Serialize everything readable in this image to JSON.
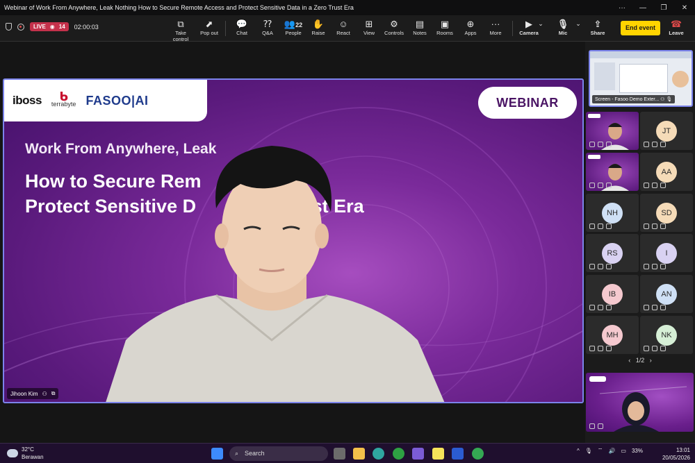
{
  "window": {
    "title": "Webinar of Work From Anywhere, Leak Nothing How to Secure Remote Access and Protect Sensitive Data in a Zero Trust Era",
    "controls": [
      "···",
      "—",
      "❐",
      "✕"
    ]
  },
  "toolbar": {
    "live_label": "LIVE",
    "viewer_count": "14",
    "timer": "02:00:03",
    "tools": [
      {
        "label": "Take control",
        "icon": "take-control-icon"
      },
      {
        "label": "Pop out",
        "icon": "pop-out-icon"
      },
      {
        "label": "Chat",
        "icon": "chat-icon"
      },
      {
        "label": "Q&A",
        "icon": "qa-icon"
      },
      {
        "label": "People",
        "icon": "people-icon",
        "count": "22"
      },
      {
        "label": "Raise",
        "icon": "raise-hand-icon"
      },
      {
        "label": "React",
        "icon": "react-icon"
      },
      {
        "label": "View",
        "icon": "view-icon"
      },
      {
        "label": "Controls",
        "icon": "controls-icon"
      },
      {
        "label": "Notes",
        "icon": "notes-icon"
      },
      {
        "label": "Rooms",
        "icon": "rooms-icon"
      },
      {
        "label": "Apps",
        "icon": "apps-icon"
      },
      {
        "label": "More",
        "icon": "more-icon"
      }
    ],
    "camera_label": "Camera",
    "mic_label": "Mic",
    "share_label": "Share",
    "end_event_label": "End event",
    "leave_label": "Leave",
    "accent_color": "#ffd400",
    "leave_color": "#e04a4a"
  },
  "stage": {
    "logos": {
      "iboss": "iboss",
      "terrabyte": "terrabyte",
      "fasoo": "FASOO|AI"
    },
    "webinar_badge": "WEBINAR",
    "slide_subtitle": "Work From Anywhere, Leak",
    "slide_heading_line1": "How to Secure Rem          s and",
    "slide_heading_line2": "Protect Sensitive D          ero Trust Era",
    "speaker_name": "Jihoon Kim",
    "frame_color": "#7b83eb"
  },
  "panel": {
    "screen_share_label": "Screen - Fasoo Demo Exter...",
    "participants": [
      {
        "initials": "",
        "type": "video"
      },
      {
        "initials": "JT",
        "color": "#f5dbb8"
      },
      {
        "initials": "",
        "type": "video"
      },
      {
        "initials": "AA",
        "color": "#f5dbb8"
      },
      {
        "initials": "NH",
        "color": "#cfe0f5"
      },
      {
        "initials": "SD",
        "color": "#f5dbb8"
      },
      {
        "initials": "RS",
        "color": "#d9d2f2"
      },
      {
        "initials": "I",
        "color": "#d9d2f2"
      },
      {
        "initials": "IB",
        "color": "#f5c9cf"
      },
      {
        "initials": "AN",
        "color": "#cfe0f5"
      },
      {
        "initials": "MH",
        "color": "#f5c9cf"
      },
      {
        "initials": "NK",
        "color": "#d6efd6"
      }
    ],
    "page_indicator": "1/2"
  },
  "taskbar": {
    "temperature": "32°C",
    "weather_text": "Berawan",
    "search_placeholder": "Search",
    "battery": "33%",
    "time": "13:01",
    "date": "20/05/2026"
  }
}
